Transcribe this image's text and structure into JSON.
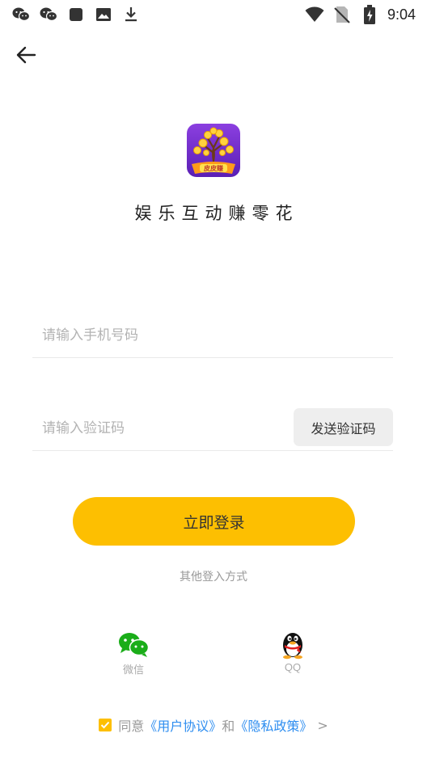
{
  "status_bar": {
    "time": "9:04",
    "left_icons": [
      "wechat-icon",
      "wechat-icon",
      "square-icon",
      "image-icon",
      "download-icon"
    ],
    "right_icons": [
      "wifi-icon",
      "no-sim-icon",
      "battery-charging-icon"
    ]
  },
  "header": {
    "back_icon": "arrow-left-icon"
  },
  "app": {
    "logo_text": "皮皮赚",
    "name": "娱乐互动赚零花"
  },
  "form": {
    "phone_placeholder": "请输入手机号码",
    "code_placeholder": "请输入验证码",
    "send_code_label": "发送验证码",
    "login_label": "立即登录"
  },
  "other_login": {
    "title": "其他登入方式",
    "options": [
      {
        "label": "微信",
        "icon": "wechat-icon"
      },
      {
        "label": "QQ",
        "icon": "qq-penguin-icon"
      }
    ]
  },
  "agreement": {
    "checked": true,
    "prefix": "同意",
    "user_agreement": "《用户协议》",
    "and": "和",
    "privacy_policy": "《隐私政策》",
    "chevron": ">"
  },
  "colors": {
    "accent": "#fdbf01",
    "link": "#2f8ef0",
    "wechat": "#1aad19"
  }
}
